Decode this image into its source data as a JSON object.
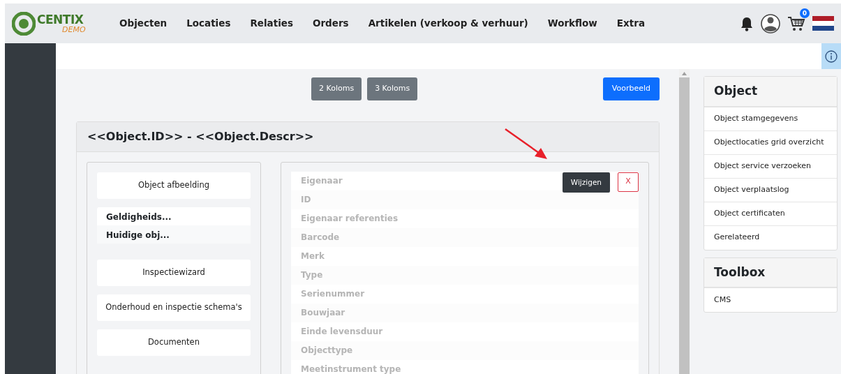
{
  "logo": {
    "name": "CENTIX",
    "tag": "DEMO"
  },
  "nav": [
    {
      "label": "Objecten"
    },
    {
      "label": "Locaties"
    },
    {
      "label": "Relaties"
    },
    {
      "label": "Orders"
    },
    {
      "label": "Artikelen (verkoop & verhuur)"
    },
    {
      "label": "Workflow"
    },
    {
      "label": "Extra"
    }
  ],
  "cart_count": "0",
  "toolbar": {
    "column_buttons": [
      "2 Koloms",
      "3 Koloms"
    ],
    "preview_button": "Voorbeeld"
  },
  "card": {
    "title": "<<Object.ID>> - <<Object.Descr>>",
    "left_blocks": [
      {
        "kind": "button",
        "label": "Object afbeelding"
      },
      {
        "kind": "list",
        "items": [
          "Geldigheids...",
          "Huidige obj..."
        ]
      },
      {
        "kind": "button",
        "label": "Inspectiewizard"
      },
      {
        "kind": "button",
        "label": "Onderhoud en inspectie schema's"
      },
      {
        "kind": "button",
        "label": "Documenten"
      }
    ],
    "edit_button": "Wijzigen",
    "close_button": "X",
    "fields": [
      "Eigenaar",
      "ID",
      "Eigenaar referenties",
      "Barcode",
      "Merk",
      "Type",
      "Serienummer",
      "Bouwjaar",
      "Einde levensduur",
      "Objecttype",
      "Meetinstrument type"
    ]
  },
  "panels": [
    {
      "title": "Object",
      "items": [
        "Object stamgegevens",
        "Objectlocaties grid overzicht",
        "Object service verzoeken",
        "Object verplaatslog",
        "Object certificaten",
        "Gerelateerd"
      ]
    },
    {
      "title": "Toolbox",
      "items": [
        "CMS"
      ]
    }
  ]
}
